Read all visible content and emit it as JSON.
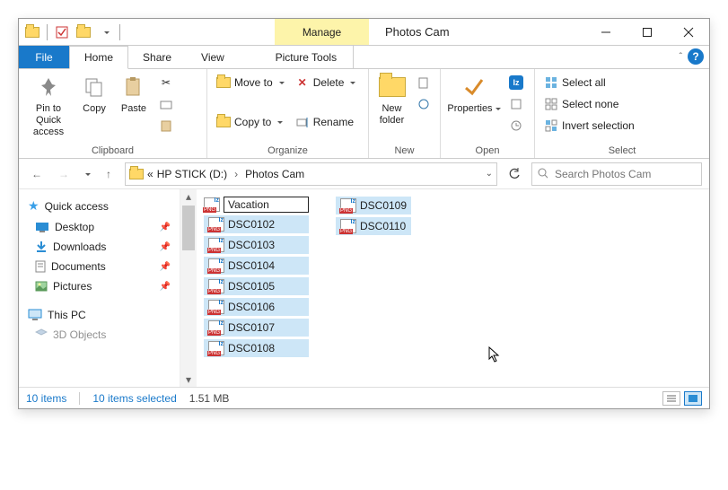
{
  "title": "Photos Cam",
  "contextual_tab": "Manage",
  "contextual_sub": "Picture Tools",
  "menu": {
    "file": "File",
    "home": "Home",
    "share": "Share",
    "view": "View"
  },
  "ribbon": {
    "clipboard": {
      "label": "Clipboard",
      "pin": "Pin to Quick access",
      "copy": "Copy",
      "paste": "Paste"
    },
    "organize": {
      "label": "Organize",
      "moveto": "Move to",
      "copyto": "Copy to",
      "delete": "Delete",
      "rename": "Rename"
    },
    "new": {
      "label": "New",
      "newfolder": "New folder"
    },
    "open": {
      "label": "Open",
      "properties": "Properties"
    },
    "select": {
      "label": "Select",
      "selall": "Select all",
      "selnone": "Select none",
      "selinv": "Invert selection"
    }
  },
  "breadcrumb": {
    "drive": "HP STICK (D:)",
    "folder": "Photos Cam"
  },
  "search_placeholder": "Search Photos Cam",
  "nav": {
    "quick": "Quick access",
    "desktop": "Desktop",
    "downloads": "Downloads",
    "documents": "Documents",
    "pictures": "Pictures",
    "thispc": "This PC",
    "obj3d": "3D Objects"
  },
  "files": {
    "rename_value": "Vacation",
    "col1": [
      "DSC0102",
      "DSC0103",
      "DSC0104",
      "DSC0105",
      "DSC0106",
      "DSC0107",
      "DSC0108"
    ],
    "col2": [
      "DSC0109",
      "DSC0110"
    ]
  },
  "status": {
    "count": "10 items",
    "selected": "10 items selected",
    "size": "1.51 MB"
  }
}
